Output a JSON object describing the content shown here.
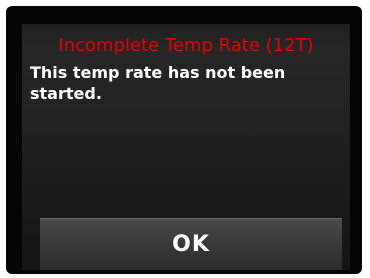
{
  "dialog": {
    "title": "Incomplete Temp Rate (12T)",
    "message": "This temp rate has not been started.",
    "ok_label": "OK"
  },
  "colors": {
    "title": "#e60000",
    "text": "#ffffff",
    "background": "#1f1f1f",
    "button": "#3a3a3a"
  }
}
